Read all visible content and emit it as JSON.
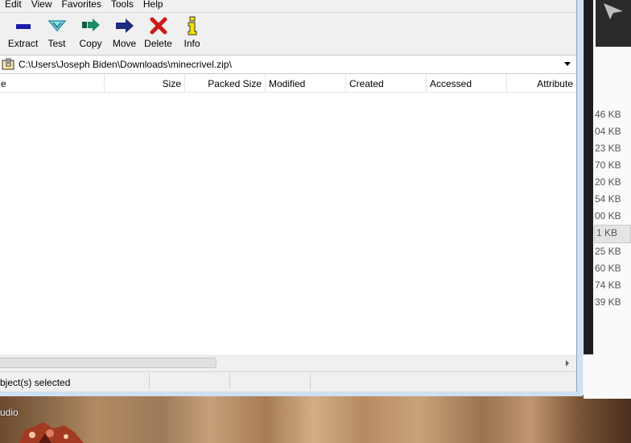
{
  "menu": [
    "Edit",
    "View",
    "Favorites",
    "Tools",
    "Help"
  ],
  "toolbar": [
    {
      "label": "Extract",
      "icon": "extract-icon"
    },
    {
      "label": "Test",
      "icon": "test-icon"
    },
    {
      "label": "Copy",
      "icon": "copy-icon"
    },
    {
      "label": "Move",
      "icon": "move-icon"
    },
    {
      "label": "Delete",
      "icon": "delete-icon"
    },
    {
      "label": "Info",
      "icon": "info-icon"
    }
  ],
  "address": {
    "path": "C:\\Users\\Joseph Biden\\Downloads\\minecrivel.zip\\"
  },
  "columns": [
    "e",
    "Size",
    "Packed Size",
    "Modified",
    "Created",
    "Accessed",
    "Attribute"
  ],
  "status": {
    "selected": "bject(s) selected"
  },
  "right_pane": {
    "sizes": [
      "46 KB",
      "04 KB",
      "23 KB",
      "70 KB",
      "20 KB",
      "54 KB",
      "00 KB",
      "1 KB",
      "25 KB",
      "60 KB",
      "74 KB",
      "39 KB"
    ]
  },
  "desktop": {
    "label": "udio"
  },
  "colors": {
    "accent_blue": "#1a1aa8",
    "test_cyan": "#2ab8c8",
    "copy_green": "#1f8a6a",
    "move_navy": "#1c2a7a",
    "delete_red": "#d01818",
    "info_yellow": "#f2e400"
  }
}
